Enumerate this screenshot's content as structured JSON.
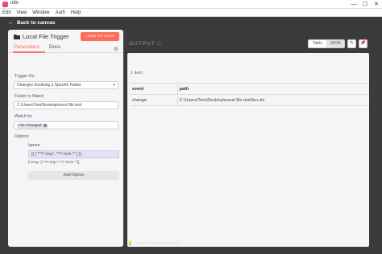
{
  "window": {
    "title": "n8n",
    "controls": {
      "minimize": "—",
      "maximize": "☐",
      "close": "✕"
    }
  },
  "menu": [
    "Edit",
    "View",
    "Window",
    "Auth",
    "Help"
  ],
  "back_label": "Back to canvas",
  "node": {
    "title": "Local File Trigger",
    "listen_button": "Listen For Event",
    "tabs": [
      "Parameters",
      "Docs"
    ]
  },
  "params": {
    "trigger_on_label": "Trigger On",
    "trigger_on_value": "Changes Involving a Specific Folder",
    "folder_label": "Folder to Watch",
    "folder_value": "C:\\Users\\Tom\\Desktop\\excel file test",
    "watch_for_label": "Watch for",
    "watch_for_chip": "File Changed",
    "options_label": "Options",
    "ignore_label": "Ignore",
    "ignore_expression": "{{ [ \"**/*.tmp\", \"**/~lock.*\" ] }}",
    "ignore_preview": "[Array: [\"**/*.tmp\",\"**/~lock.*\"]]",
    "add_option": "Add Option"
  },
  "output": {
    "title": "OUTPUT",
    "view_toggle": [
      "Table",
      "JSON"
    ],
    "selected_view": "JSON",
    "item_count": "1 item",
    "columns": [
      "event",
      "path"
    ],
    "rows": [
      {
        "event": "change",
        "path": "C:\\Users\\Tom\\Desktop\\excel file test\\foo.xls"
      }
    ]
  },
  "hint": "I wish this node would...",
  "colors": {
    "accent": "#ff6d5a",
    "canvas": "#3b3b3b",
    "panel": "#f5f5f7",
    "brand": "#ea4b71"
  }
}
